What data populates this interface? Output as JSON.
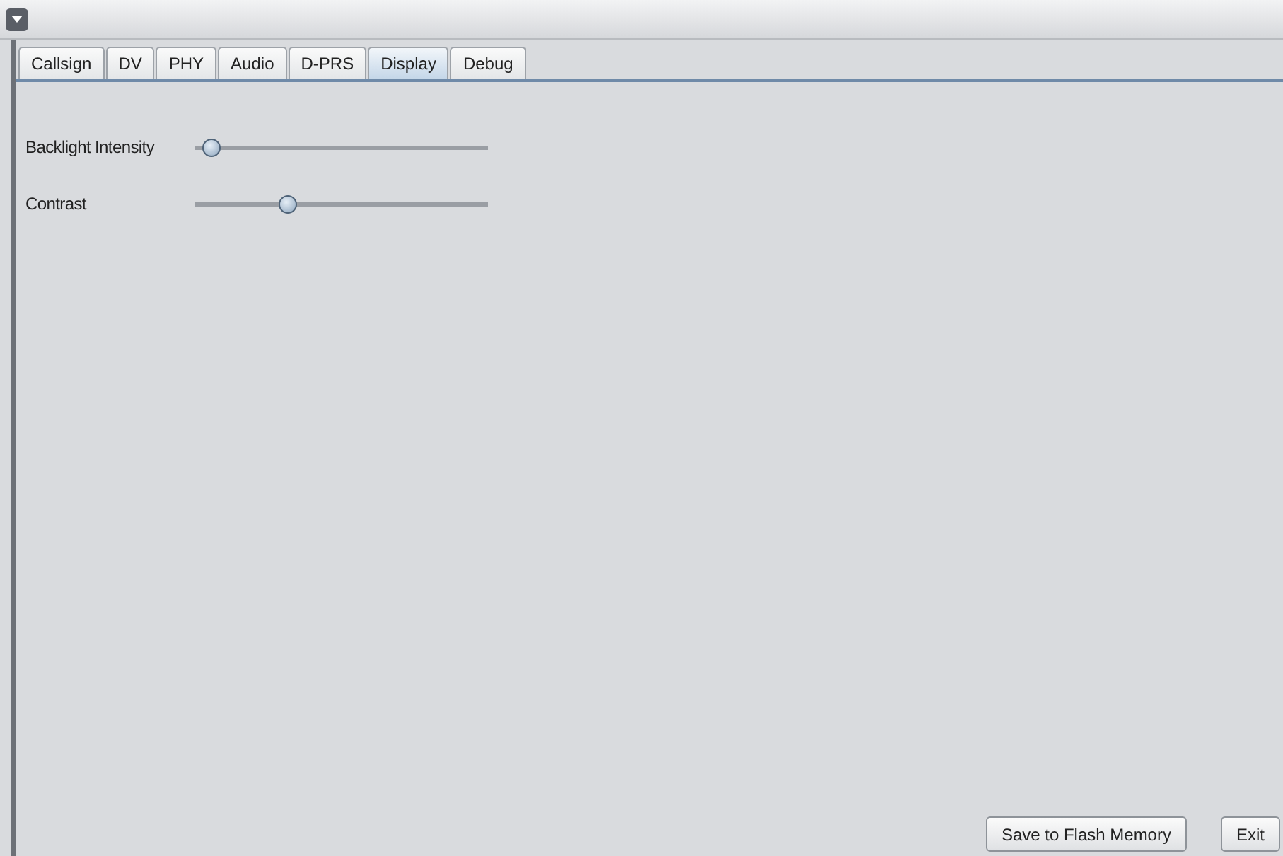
{
  "tabs": [
    {
      "label": "Callsign",
      "selected": false
    },
    {
      "label": "DV",
      "selected": false
    },
    {
      "label": "PHY",
      "selected": false
    },
    {
      "label": "Audio",
      "selected": false
    },
    {
      "label": "D-PRS",
      "selected": false
    },
    {
      "label": "Display",
      "selected": true
    },
    {
      "label": "Debug",
      "selected": false
    }
  ],
  "sliders": [
    {
      "label": "Backlight Intensity",
      "level": 0.04
    },
    {
      "label": "Contrast",
      "level": 0.31
    }
  ],
  "buttons": [
    "Save to Flash Memory",
    "Exit"
  ]
}
